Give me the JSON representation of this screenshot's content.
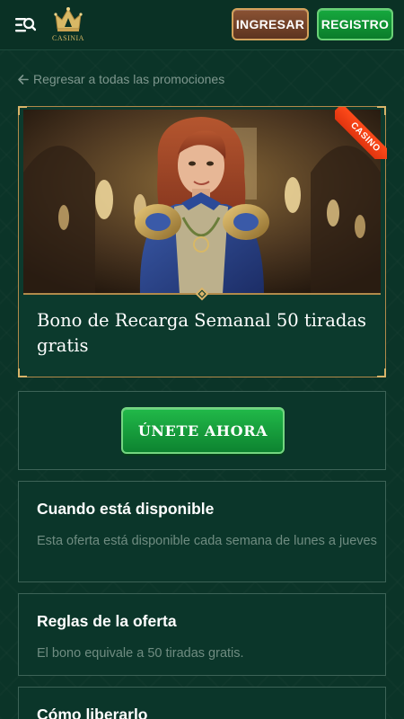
{
  "header": {
    "logo_text": "CASINIA",
    "login_label": "INGRESAR",
    "register_label": "REGISTRO"
  },
  "back_link": "Regresar a todas las promociones",
  "promo": {
    "badge": "CASINO",
    "title": "Bono de Recarga Semanal 50 tiradas gratis"
  },
  "join_button": "ÚNETE AHORA",
  "sections": [
    {
      "title": "Cuando está disponible",
      "text": "Esta oferta está disponible cada semana de lunes a jueves"
    },
    {
      "title": "Reglas de la oferta",
      "text": "El bono equivale a 50 tiradas gratis."
    },
    {
      "title": "Cómo liberarlo"
    }
  ],
  "colors": {
    "background": "#0b3428",
    "gold": "#b18a4a",
    "green_button": "#16a93e",
    "brown_button": "#8a5233",
    "ribbon": "#ff4b1a"
  }
}
